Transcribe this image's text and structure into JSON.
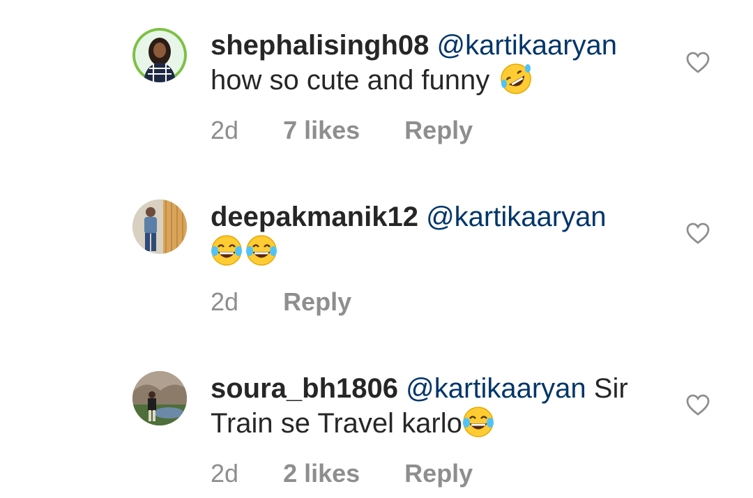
{
  "comments": [
    {
      "username": "shephalisingh08",
      "mention": "@kartikaaryan",
      "text_line1": "",
      "text_line2": "how so cute and funny",
      "emoji": "rolling-on-floor-laughing",
      "time": "2d",
      "likes": "7 likes",
      "reply": "Reply",
      "avatar_color": "#4caf50"
    },
    {
      "username": "deepakmanik12",
      "mention": "@kartikaaryan",
      "text_line1": "",
      "text_line2": "",
      "emoji": "face-with-tears-of-joy",
      "emoji_count": 2,
      "time": "2d",
      "likes": "",
      "reply": "Reply",
      "avatar_color": "#b0bec5"
    },
    {
      "username": "soura_bh1806",
      "mention": "@kartikaaryan",
      "text_line1": "Sir",
      "text_line2": "Train se Travel karlo",
      "emoji": "face-with-tears-of-joy",
      "time": "2d",
      "likes": "2 likes",
      "reply": "Reply",
      "avatar_color": "#8d6e63"
    }
  ],
  "colors": {
    "username": "#262626",
    "mention": "#003569",
    "meta": "#8e8e8e",
    "emoji_yellow": "#ffcc33"
  }
}
